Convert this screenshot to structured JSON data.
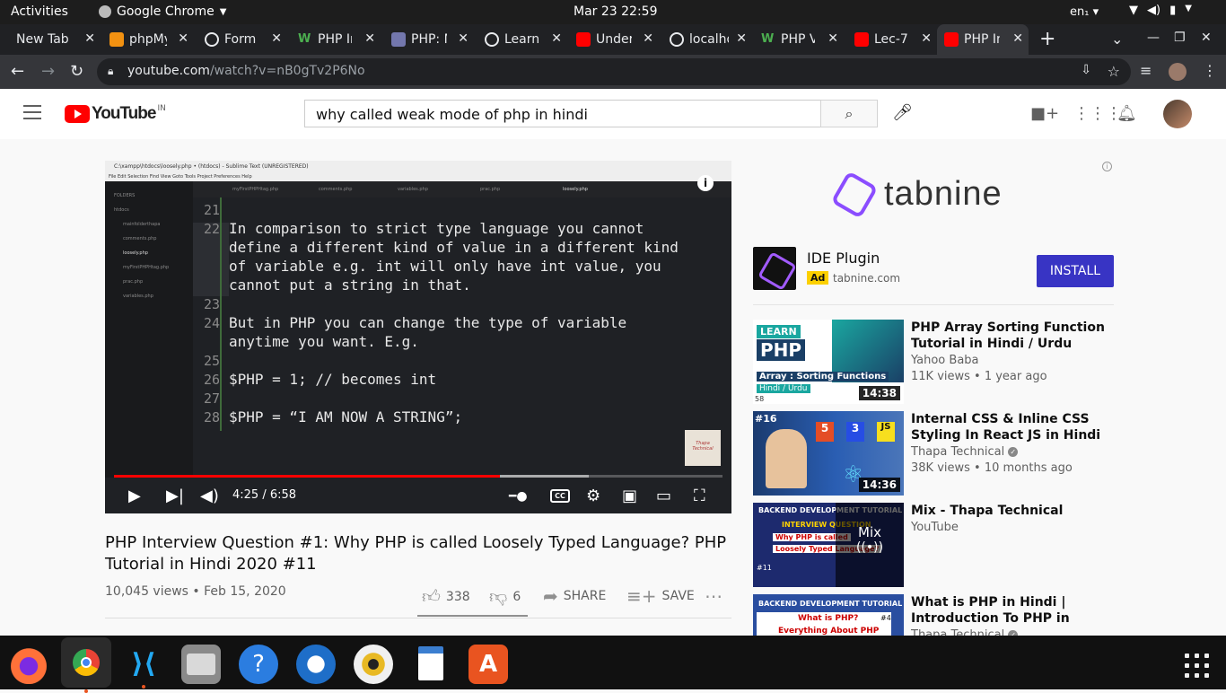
{
  "topbar": {
    "activities": "Activities",
    "app_name": "Google Chrome",
    "clock": "Mar 23  22:59",
    "lang": "en₁"
  },
  "browser": {
    "tabs": [
      {
        "label": "New Tab",
        "icon": "none"
      },
      {
        "label": "phpMyAdmin",
        "icon": "phpmyadmin-icon"
      },
      {
        "label": "Form",
        "icon": "globe-icon"
      },
      {
        "label": "PHP Introduction",
        "icon": "w3schools-icon"
      },
      {
        "label": "PHP: Manual",
        "icon": "php-icon"
      },
      {
        "label": "Learn",
        "icon": "globe-icon"
      },
      {
        "label": "Under",
        "icon": "youtube-icon"
      },
      {
        "label": "localhost",
        "icon": "globe-icon"
      },
      {
        "label": "PHP Variables",
        "icon": "w3schools-icon"
      },
      {
        "label": "Lec-7",
        "icon": "youtube-icon"
      },
      {
        "label": "PHP Interview",
        "icon": "youtube-icon",
        "active": true
      }
    ],
    "url_host": "youtube.com",
    "url_path": "/watch?v=nB0gTv2P6No"
  },
  "youtube": {
    "logo_text": "YouTube",
    "country": "IN",
    "search_value": "why called weak mode of php in hindi"
  },
  "player": {
    "editor_title": "C:\\xampp\\htdocs\\loosely.php • (htdocs) - Sublime Text (UNREGISTERED)",
    "editor_menu": "File   Edit   Selection   Find   View   Goto   Tools   Project   Preferences   Help",
    "folders_label": "FOLDERS",
    "folders": [
      "htdocs",
      "mainfolderthapa",
      "comments.php",
      "loosely.php",
      "myFirstPHPHtag.php",
      "prac.php",
      "variables.php"
    ],
    "tabs": [
      "myFirstPHPHtag.php",
      "comments.php",
      "variables.php",
      "prac.php",
      "loosely.php"
    ],
    "code_lines": [
      {
        "n": "21",
        "t": ""
      },
      {
        "n": "22",
        "t": "In comparison to strict type language you cannot"
      },
      {
        "n": "",
        "t": "define a different kind of value in a different kind"
      },
      {
        "n": "",
        "t": "of variable e.g. int will only have int value, you"
      },
      {
        "n": "",
        "t": "cannot put a string in that."
      },
      {
        "n": "23",
        "t": ""
      },
      {
        "n": "24",
        "t": "But in PHP you can change the type of variable"
      },
      {
        "n": "",
        "t": "anytime you want. E.g."
      },
      {
        "n": "25",
        "t": ""
      },
      {
        "n": "26",
        "t": "$PHP = 1; // becomes int"
      },
      {
        "n": "27",
        "t": ""
      },
      {
        "n": "28",
        "t": "$PHP = “I AM NOW A STRING”;"
      }
    ],
    "watermark": "Thapa Technical",
    "time": "4:25 / 6:58",
    "progress": 0.634,
    "cc": "CC"
  },
  "video": {
    "title": "PHP Interview Question #1: Why PHP is called Loosely Typed Language? PHP Tutorial in Hindi 2020 #11",
    "meta": "10,045 views • Feb 15, 2020",
    "likes": "338",
    "dislikes": "6",
    "share": "SHARE",
    "save": "SAVE"
  },
  "ad": {
    "brand": "tabnine",
    "title": "IDE Plugin",
    "tag": "Ad",
    "domain": "tabnine.com",
    "button": "INSTALL"
  },
  "recommendations": [
    {
      "title": "PHP Array Sorting Function Tutorial in Hindi / Urdu",
      "channel": "Yahoo Baba",
      "verified": false,
      "stats": "11K views • 1 year ago",
      "duration": "14:38",
      "thumb_lines": [
        "LEARN",
        "PHP",
        "Array : Sorting Functions",
        "Hindi / Urdu",
        "58"
      ]
    },
    {
      "title": "Internal CSS & Inline CSS Styling In React JS in Hindi in...",
      "channel": "Thapa Technical",
      "verified": true,
      "stats": "38K views • 10 months ago",
      "duration": "14:36",
      "thumb_lines": [
        "#16",
        "5",
        "3",
        "JS"
      ]
    },
    {
      "title": "Mix - Thapa Technical",
      "channel": "YouTube",
      "verified": false,
      "stats": "",
      "duration": "",
      "thumb_lines": [
        "BACKEND DEVELOPMENT TUTORIAL",
        "INTERVIEW QUESTION",
        "Why PHP is called",
        "Loosely Typed Language?",
        "#11",
        "Mix"
      ]
    },
    {
      "title": "What is PHP in Hindi | Introduction To PHP in Hindi in...",
      "channel": "Thapa Technical",
      "verified": true,
      "stats": "",
      "duration": "",
      "thumb_lines": [
        "BACKEND DEVELOPMENT TUTORIAL",
        "What is PHP?",
        "Everything About PHP",
        "#4"
      ]
    }
  ],
  "taskbar": [
    "firefox-icon",
    "chrome-icon",
    "vscode-icon",
    "files-icon",
    "help-icon",
    "thunderbird-icon",
    "rhythmbox-icon",
    "text-editor-icon",
    "software-center-icon"
  ]
}
